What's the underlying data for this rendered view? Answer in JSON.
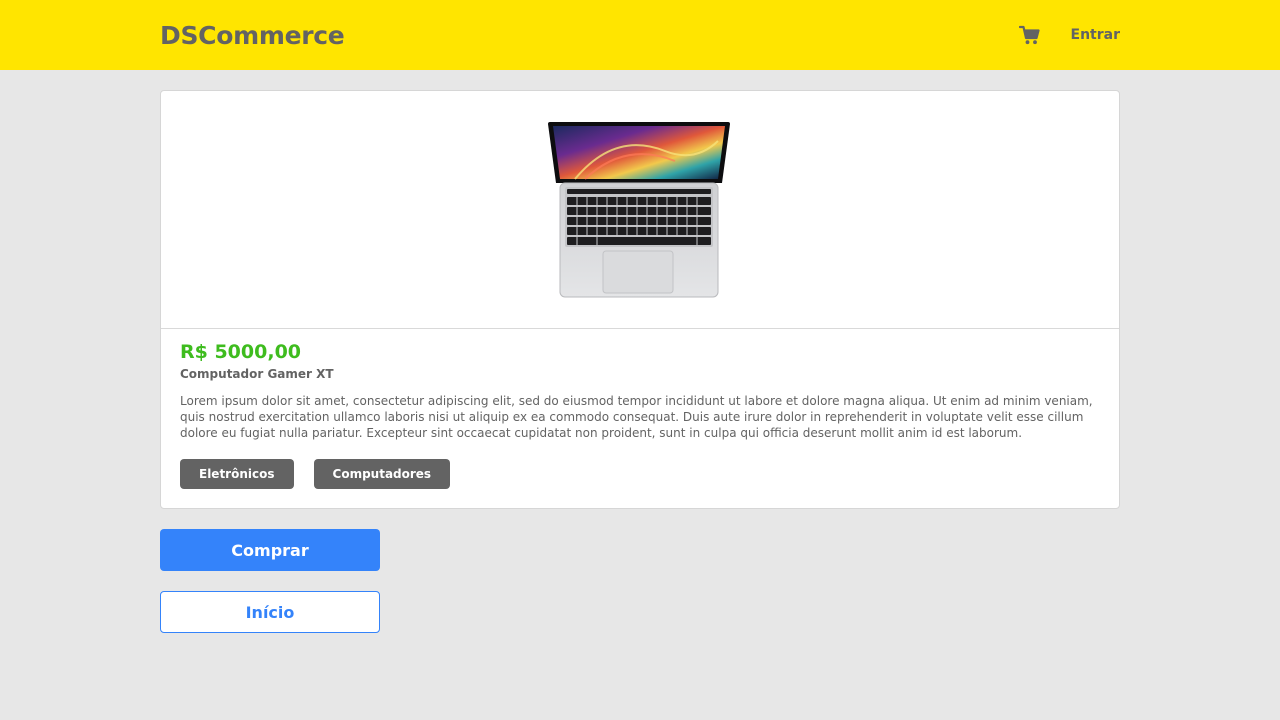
{
  "header": {
    "brand": "DSCommerce",
    "cart_icon": "cart-icon",
    "login_label": "Entrar",
    "colors": {
      "background": "#ffe500",
      "text": "#636363"
    }
  },
  "product": {
    "image_icon": "laptop-image",
    "price": "R$ 5000,00",
    "name": "Computador Gamer XT",
    "description": "Lorem ipsum dolor sit amet, consectetur adipiscing elit, sed do eiusmod tempor incididunt ut labore et dolore magna aliqua. Ut enim ad minim veniam, quis nostrud exercitation ullamco laboris nisi ut aliquip ex ea commodo consequat. Duis aute irure dolor in reprehenderit in voluptate velit esse cillum dolore eu fugiat nulla pariatur. Excepteur sint occaecat cupidatat non proident, sunt in culpa qui officia deserunt mollit anim id est laborum.",
    "categories": [
      "Eletrônicos",
      "Computadores"
    ],
    "colors": {
      "price": "#3ebc1e",
      "pill": "#636363"
    }
  },
  "actions": {
    "buy_label": "Comprar",
    "home_label": "Início",
    "colors": {
      "primary": "#3483fa"
    }
  },
  "page": {
    "background": "#e7e7e7"
  }
}
